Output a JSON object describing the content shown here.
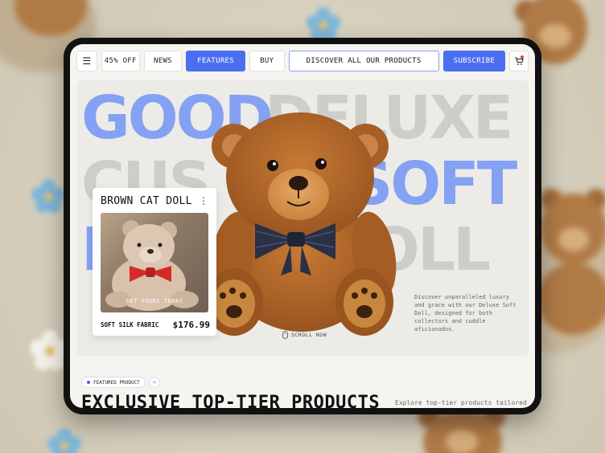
{
  "nav": {
    "discount": "45% OFF",
    "news": "NEWS",
    "features": "FEATURES",
    "buy": "BUY",
    "discover": "DISCOVER ALL OUR PRODUCTS",
    "subscribe": "SUBSCRIBE"
  },
  "hero": {
    "row1": [
      "GOOD",
      "DELUXE"
    ],
    "row2": [
      "CUS",
      "SOFT"
    ],
    "row3": [
      "D",
      "OLL"
    ],
    "scroll_label": "SCROLL NOW",
    "description": "Discover unparalleled luxury and grace with our Deluxe Soft Doll, designed for both collectors and cuddle aficionados."
  },
  "card": {
    "title": "BROWN CAT DOLL",
    "cta": "GET YOURS TODAY",
    "fabric": "SOFT SILK FABRIC",
    "price": "$176.99"
  },
  "featured": {
    "pill": "FEATURED PRODUCT",
    "heading": "EXCLUSIVE TOP-TIER PRODUCTS",
    "explore": "Explore top-tier products tailored"
  },
  "colors": {
    "accent": "#4b6ef0",
    "hero_blue": "#84a1f3",
    "hero_grey": "#cfcdca"
  }
}
